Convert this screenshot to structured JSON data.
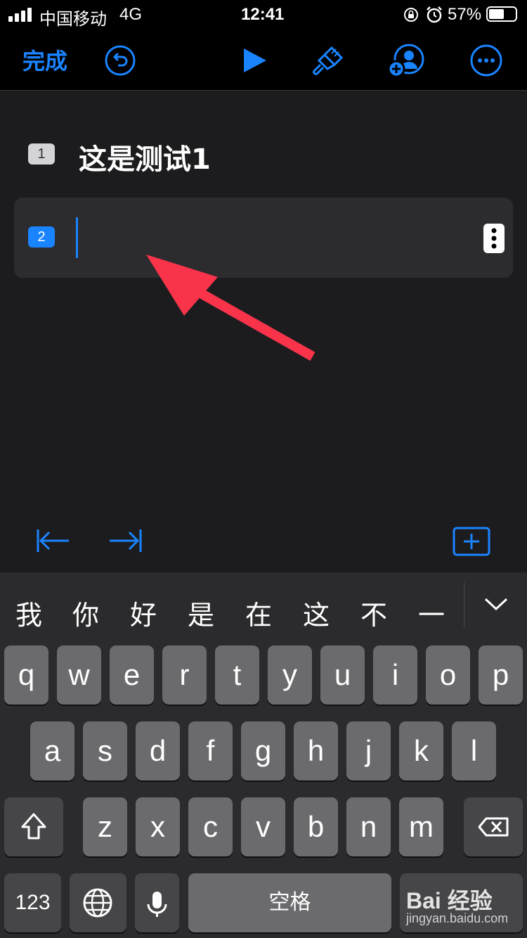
{
  "status_bar": {
    "carrier": "中国移动",
    "network": "4G",
    "time": "12:41",
    "battery": "57%",
    "battery_level": 0.57
  },
  "toolbar": {
    "done_label": "完成",
    "icons": [
      "undo-icon",
      "play-icon",
      "brush-icon",
      "add-person-icon",
      "more-icon"
    ]
  },
  "outline": {
    "rows": [
      {
        "number": "1",
        "text": "这是测试1"
      },
      {
        "number": "2",
        "text": ""
      }
    ]
  },
  "accessory_bar": {
    "icons": [
      "outdent-icon",
      "indent-icon",
      "add-row-icon"
    ]
  },
  "keyboard": {
    "candidates": [
      "我",
      "你",
      "好",
      "是",
      "在",
      "这",
      "不",
      "一"
    ],
    "row1": [
      "q",
      "w",
      "e",
      "r",
      "t",
      "y",
      "u",
      "i",
      "o",
      "p"
    ],
    "row2": [
      "a",
      "s",
      "d",
      "f",
      "g",
      "h",
      "j",
      "k",
      "l"
    ],
    "row3": [
      "z",
      "x",
      "c",
      "v",
      "b",
      "n",
      "m"
    ],
    "numbers_key": "123",
    "space_key": "空格"
  },
  "watermark": {
    "text": "Bai 经验",
    "url": "jingyan.baidu.com"
  },
  "colors": {
    "accent": "#1a84ff",
    "annotation_arrow": "#f8334a"
  }
}
